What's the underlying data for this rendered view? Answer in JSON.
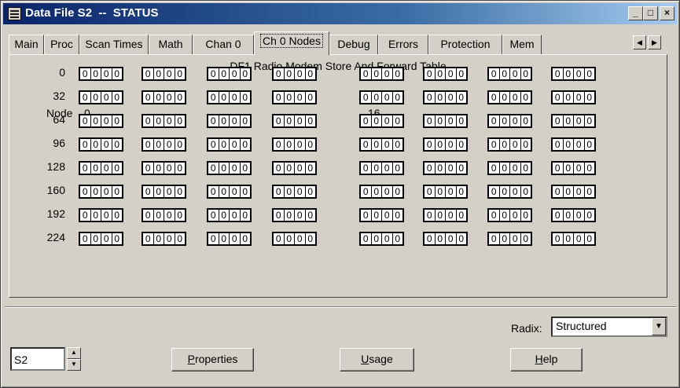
{
  "window": {
    "title": "Data File S2  --  STATUS",
    "minimize": "_",
    "maximize": "□",
    "close": "×"
  },
  "tabs": [
    {
      "label": "Main"
    },
    {
      "label": "Proc"
    },
    {
      "label": "Scan Times"
    },
    {
      "label": "Math"
    },
    {
      "label": "Chan 0"
    },
    {
      "label": "Ch 0 Nodes",
      "active": true
    },
    {
      "label": "Debug"
    },
    {
      "label": "Errors"
    },
    {
      "label": "Protection"
    },
    {
      "label": "Mem"
    }
  ],
  "tab_scroll": {
    "left": "◀",
    "right": "▶"
  },
  "table": {
    "title": "DF1 Radio Modem Store And Forward Table",
    "node_label": "Node",
    "col_headers": [
      "0",
      "16"
    ],
    "rows": [
      {
        "label": "0"
      },
      {
        "label": "32"
      },
      {
        "label": "64"
      },
      {
        "label": "96"
      },
      {
        "label": "128"
      },
      {
        "label": "160"
      },
      {
        "label": "192"
      },
      {
        "label": "224"
      }
    ],
    "bit_value": "0"
  },
  "radix": {
    "label": "Radix:",
    "value": "Structured"
  },
  "file": {
    "value": "S2"
  },
  "buttons": {
    "properties": {
      "key": "P",
      "rest": "roperties"
    },
    "usage": {
      "key": "U",
      "rest": "sage"
    },
    "help": {
      "key": "H",
      "rest": "elp"
    }
  },
  "icons": {
    "spin_up": "▲",
    "spin_down": "▼",
    "combo_arrow": "▼"
  }
}
